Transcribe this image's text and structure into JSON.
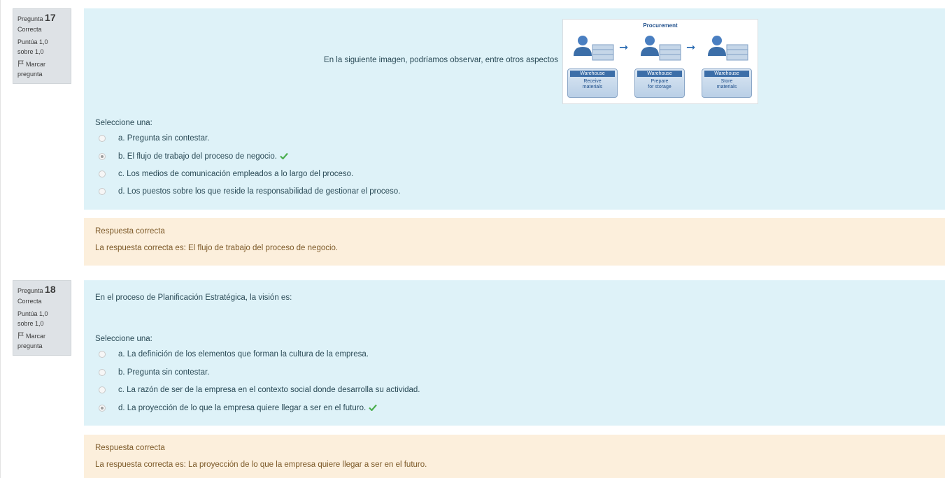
{
  "questions": [
    {
      "info": {
        "label": "Pregunta",
        "number": "17",
        "state": "Correcta",
        "grade_line1": "Puntúa 1,0",
        "grade_line2": "sobre 1,0",
        "flag_line1": "Marcar",
        "flag_line2": "pregunta"
      },
      "text": "En la siguiente imagen, podríamos observar, entre otros aspectos",
      "image": {
        "title": "Procurement",
        "steps": [
          {
            "header": "Warehouse",
            "line1": "Receive",
            "line2": "materials"
          },
          {
            "header": "Warehouse",
            "line1": "Prepare",
            "line2": "for storage"
          },
          {
            "header": "Warehouse",
            "line1": "Store",
            "line2": "materials"
          }
        ]
      },
      "prompt": "Seleccione una:",
      "answers": [
        {
          "text": "a. Pregunta sin contestar.",
          "selected": false,
          "correct": false
        },
        {
          "text": "b. El flujo de trabajo del proceso de negocio.",
          "selected": true,
          "correct": true
        },
        {
          "text": "c. Los medios de comunicación empleados a lo largo del proceso.",
          "selected": false,
          "correct": false
        },
        {
          "text": "d. Los puestos sobre los que reside la responsabilidad de gestionar el proceso.",
          "selected": false,
          "correct": false
        }
      ],
      "feedback": {
        "title": "Respuesta correcta",
        "right_answer": "La respuesta correcta es: El flujo de trabajo del proceso de negocio."
      }
    },
    {
      "info": {
        "label": "Pregunta",
        "number": "18",
        "state": "Correcta",
        "grade_line1": "Puntúa 1,0",
        "grade_line2": "sobre 1,0",
        "flag_line1": "Marcar",
        "flag_line2": "pregunta"
      },
      "text": "En el proceso de Planificación Estratégica, la visión es:",
      "prompt": "Seleccione una:",
      "answers": [
        {
          "text": "a. La definición de los elementos que forman la cultura de la empresa.",
          "selected": false,
          "correct": false
        },
        {
          "text": "b. Pregunta sin contestar.",
          "selected": false,
          "correct": false
        },
        {
          "text": "c. La razón de ser de la empresa en el contexto social donde desarrolla su actividad.",
          "selected": false,
          "correct": false
        },
        {
          "text": "d. La proyección de lo que la empresa quiere llegar a ser en el futuro.",
          "selected": true,
          "correct": true
        }
      ],
      "feedback": {
        "title": "Respuesta correcta",
        "right_answer": "La respuesta correcta es: La proyección de lo que la empresa quiere llegar a ser en el futuro."
      }
    }
  ],
  "colors": {
    "formulation_bg": "#def2f8",
    "feedback_bg": "#fcefdc",
    "info_bg": "#dee2e6",
    "check": "#4caf50"
  }
}
